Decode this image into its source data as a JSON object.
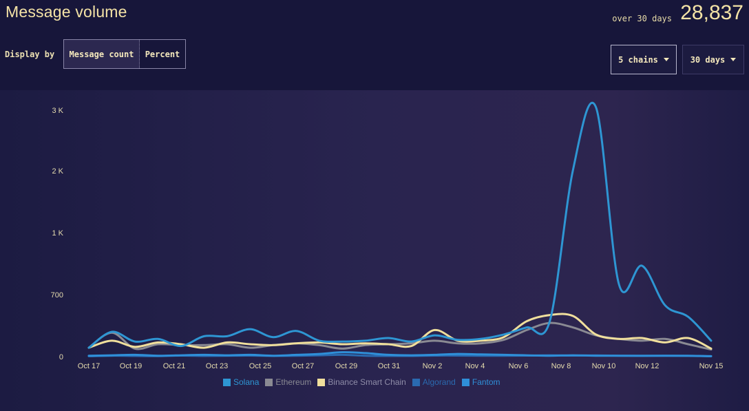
{
  "header": {
    "title": "Message volume",
    "total_label": "over 30 days",
    "total_value": "28,837"
  },
  "controls": {
    "display_label": "Display by",
    "display_options": [
      "Message count",
      "Percent"
    ],
    "active_option": "Message count",
    "chains_dropdown": "5 chains",
    "days_dropdown": "30 days"
  },
  "colors": {
    "text_accent": "#f4e3a6",
    "background": "#17163a"
  },
  "chart_data": {
    "type": "line",
    "y_ticks": [
      "0",
      "700",
      "1 K",
      "2 K",
      "3 K"
    ],
    "x_tick_labels": [
      "Oct 17",
      "Oct 19",
      "Oct 21",
      "Oct 23",
      "Oct 25",
      "Oct 27",
      "Oct 29",
      "Oct 31",
      "Nov 2",
      "Nov 4",
      "Nov 6",
      "Nov 8",
      "Nov 10",
      "Nov 12",
      "Nov 15"
    ],
    "series": [
      {
        "name": "Solana",
        "color": "#2e96d3",
        "values": [
          100,
          280,
          170,
          200,
          120,
          230,
          230,
          310,
          220,
          290,
          180,
          170,
          180,
          210,
          170,
          240,
          190,
          200,
          250,
          330,
          400,
          2000,
          3050,
          750,
          840,
          580,
          450,
          180
        ]
      },
      {
        "name": "Ethereum",
        "color": "#8a8a93",
        "values": [
          100,
          270,
          90,
          140,
          130,
          130,
          140,
          100,
          130,
          150,
          130,
          90,
          130,
          140,
          150,
          180,
          150,
          150,
          190,
          300,
          380,
          330,
          240,
          200,
          180,
          200,
          140,
          80
        ]
      },
      {
        "name": "Binance Smart Chain",
        "color": "#f0df9c",
        "values": [
          100,
          180,
          110,
          160,
          140,
          100,
          160,
          140,
          130,
          150,
          160,
          140,
          150,
          140,
          120,
          300,
          180,
          180,
          220,
          400,
          470,
          460,
          250,
          200,
          210,
          160,
          210,
          90
        ]
      },
      {
        "name": "Algorand",
        "color": "#2a6ab0",
        "values": [
          5,
          10,
          8,
          6,
          12,
          8,
          10,
          12,
          8,
          10,
          15,
          20,
          10,
          8,
          8,
          12,
          12,
          10,
          10,
          12,
          15,
          12,
          14,
          10,
          8,
          10,
          8,
          5
        ]
      },
      {
        "name": "Fantom",
        "color": "#2f8fd8",
        "values": [
          10,
          15,
          20,
          10,
          15,
          20,
          15,
          20,
          10,
          20,
          30,
          50,
          40,
          20,
          15,
          20,
          30,
          25,
          20,
          15,
          10,
          15,
          10,
          10,
          10,
          10,
          10,
          5
        ]
      }
    ]
  }
}
